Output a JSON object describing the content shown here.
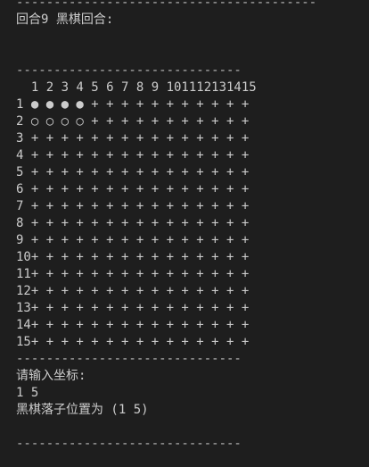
{
  "terminal": {
    "top_divider": "----------------------------------------",
    "turn_line": "回合9 黑棋回合:",
    "board_divider_top": "------------------------------",
    "board_lines": [
      "  1 2 3 4 5 6 7 8 9 101112131415",
      "1 ● ● ● ● + + + + + + + + + + +",
      "2 ○ ○ ○ ○ + + + + + + + + + + +",
      "3 + + + + + + + + + + + + + + +",
      "4 + + + + + + + + + + + + + + +",
      "5 + + + + + + + + + + + + + + +",
      "6 + + + + + + + + + + + + + + +",
      "7 + + + + + + + + + + + + + + +",
      "8 + + + + + + + + + + + + + + +",
      "9 + + + + + + + + + + + + + + +",
      "10+ + + + + + + + + + + + + + +",
      "11+ + + + + + + + + + + + + + +",
      "12+ + + + + + + + + + + + + + +",
      "13+ + + + + + + + + + + + + + +",
      "14+ + + + + + + + + + + + + + +",
      "15+ + + + + + + + + + + + + + +"
    ],
    "board_divider_bottom": "------------------------------",
    "input_prompt": "请输入坐标:",
    "input_value": "1 5",
    "placement_result": "黑棋落子位置为 (1 5)",
    "bottom_divider": "------------------------------"
  }
}
